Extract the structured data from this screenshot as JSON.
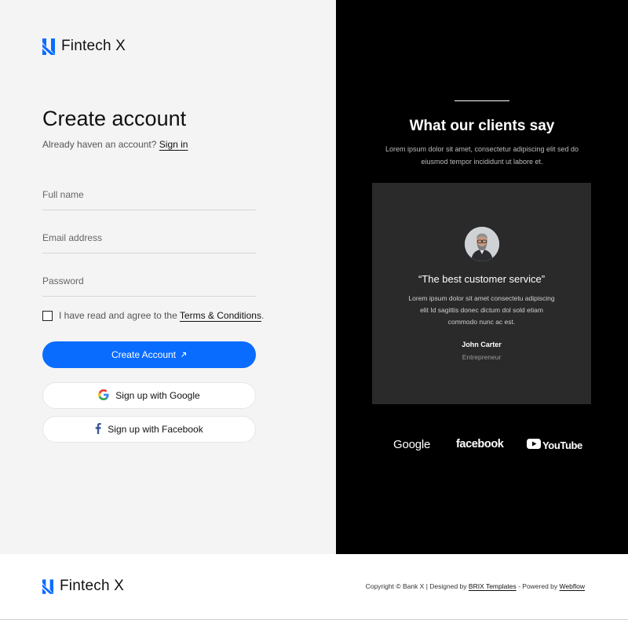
{
  "brand": {
    "name": "Fintech X",
    "color": "#0a6cff"
  },
  "form": {
    "title": "Create account",
    "signin_prompt": "Already haven an account?",
    "signin_link": "Sign in",
    "fields": {
      "full_name_placeholder": "Full name",
      "email_placeholder": "Email address",
      "password_placeholder": "Password"
    },
    "terms_text": "I have read and agree to the",
    "terms_link": "Terms & Conditions",
    "terms_suffix": ".",
    "terms_checked": false,
    "submit_label": "Create Account",
    "submit_icon": "arrow-up-right-icon",
    "google_label": "Sign up with Google",
    "facebook_label": "Sign up with Facebook"
  },
  "testimonials": {
    "title": "What our clients say",
    "subtitle": "Lorem ipsum dolor sit amet, consectetur adipiscing elit sed do eiusmod tempor incididunt ut labore et.",
    "card": {
      "quote": "“The best customer service”",
      "body": "Lorem ipsum dolor sit amet consectetu adipiscing elit Id sagittis donec dictum dol sold etiam commodo nunc ac est.",
      "author": "John Carter",
      "role": "Entrepreneur"
    },
    "logos": [
      "Google",
      "facebook",
      "YouTube"
    ]
  },
  "footer": {
    "brand_name": "Fintech X",
    "copyright_prefix": "Copyright © Bank X | Designed by",
    "designer_link": "BRIX Templates",
    "powered_prefix": "- Powered by",
    "powered_link": "Webflow"
  },
  "colors": {
    "primary": "#0a6cff",
    "left_bg": "#f4f4f4",
    "right_bg": "#000000",
    "card_bg": "#2a2a2a"
  }
}
